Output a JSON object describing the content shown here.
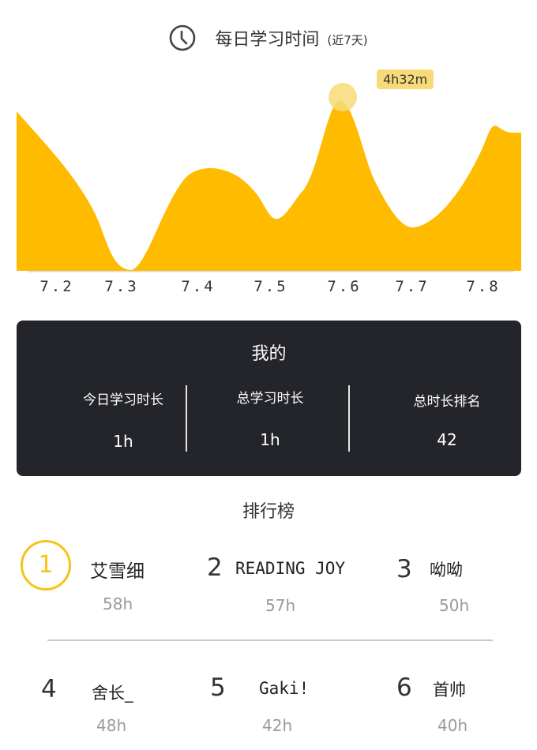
{
  "header": {
    "title": "每日学习时间",
    "subtitle": "(近7天)",
    "icon": "clock-icon"
  },
  "chart_data": {
    "type": "area",
    "categories": [
      "7.2",
      "7.3",
      "7.4",
      "7.5",
      "7.6",
      "7.7",
      "7.8"
    ],
    "values": [
      2.8,
      0,
      1.8,
      1.0,
      3.0,
      0.8,
      2.3
    ],
    "peak_label": "4h32m",
    "peak_category": "7.6",
    "color": "#ffbb00",
    "highlight_color": "#f7db79"
  },
  "mine": {
    "title": "我的",
    "stats": [
      {
        "label": "今日学习时长",
        "value": "1h"
      },
      {
        "label": "总学习时长",
        "value": "1h"
      },
      {
        "label": "总时长排名",
        "value": "42"
      }
    ]
  },
  "ranking": {
    "title": "排行榜",
    "items": [
      {
        "rank": "1",
        "name": "艾雪细",
        "hours": "58h"
      },
      {
        "rank": "2",
        "name": "READING JOY",
        "hours": "57h"
      },
      {
        "rank": "3",
        "name": "呦呦",
        "hours": "50h"
      },
      {
        "rank": "4",
        "name": "舍长_",
        "hours": "48h"
      },
      {
        "rank": "5",
        "name": "Gaki!",
        "hours": "42h"
      },
      {
        "rank": "6",
        "name": "首帅",
        "hours": "40h"
      }
    ]
  },
  "colors": {
    "accent": "#ffbb00",
    "gold": "#f8c317",
    "card_bg": "#24252b"
  }
}
